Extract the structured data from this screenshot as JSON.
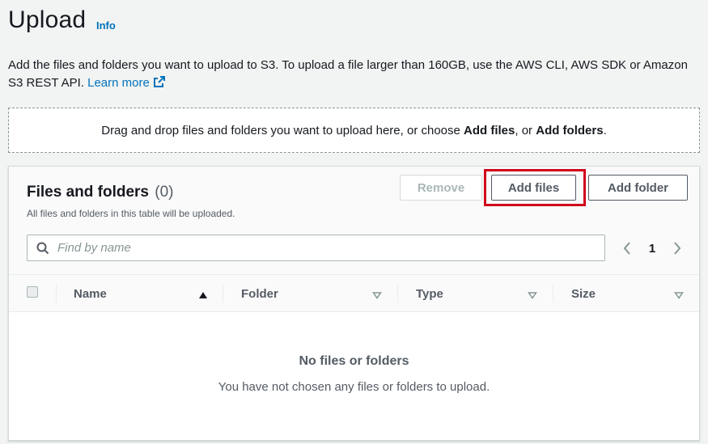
{
  "header": {
    "title": "Upload",
    "info_link": "Info"
  },
  "description": {
    "text": "Add the files and folders you want to upload to S3. To upload a file larger than 160GB, use the AWS CLI, AWS SDK or Amazon S3 REST API.",
    "learn_more": "Learn more"
  },
  "dropzone": {
    "prefix": "Drag and drop files and folders you want to upload here, or choose ",
    "add_files": "Add files",
    "middle": ", or ",
    "add_folders": "Add folders",
    "suffix": "."
  },
  "files_panel": {
    "title": "Files and folders",
    "count": "(0)",
    "subtitle": "All files and folders in this table will be uploaded.",
    "remove_label": "Remove",
    "add_files_label": "Add files",
    "add_folder_label": "Add folder",
    "search_placeholder": "Find by name",
    "page_number": "1"
  },
  "table": {
    "columns": [
      {
        "label": "Name",
        "sort": "ascending"
      },
      {
        "label": "Folder",
        "sort": "none"
      },
      {
        "label": "Type",
        "sort": "none"
      },
      {
        "label": "Size",
        "sort": "none"
      }
    ],
    "empty_title": "No files or folders",
    "empty_description": "You have not chosen any files or folders to upload."
  },
  "colors": {
    "link": "#0073bb",
    "highlight": "#d0021b",
    "text_secondary": "#545b64"
  }
}
